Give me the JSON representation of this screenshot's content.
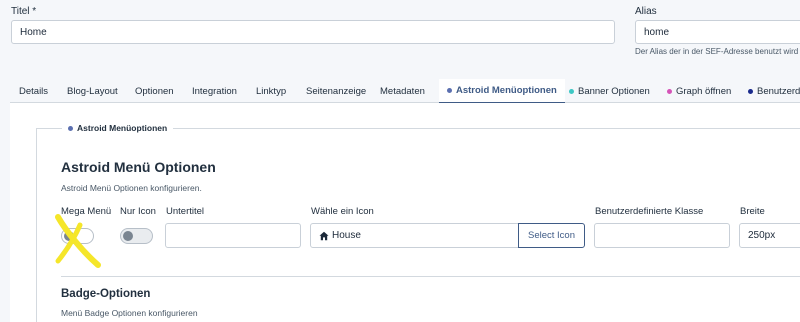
{
  "fields": {
    "title_label": "Titel *",
    "title_value": "Home",
    "alias_label": "Alias",
    "alias_value": "home",
    "alias_hint": "Der Alias der in der SEF-Adresse benutzt wird"
  },
  "tabs": [
    {
      "label": "Details"
    },
    {
      "label": "Blog-Layout"
    },
    {
      "label": "Optionen"
    },
    {
      "label": "Integration"
    },
    {
      "label": "Linktyp"
    },
    {
      "label": "Seitenanzeige"
    },
    {
      "label": "Metadaten"
    },
    {
      "label": "Astroid Menüoptionen",
      "dot": "#5b6fb0",
      "active": true
    },
    {
      "label": "Banner Optionen",
      "dot": "#3cc7c4"
    },
    {
      "label": "Graph öffnen",
      "dot": "#d554b8"
    },
    {
      "label": "Benutzerd",
      "dot": "#1a2a8c"
    }
  ],
  "fieldset": {
    "legend": "Astroid Menüoptionen",
    "legend_dot": "#5b6fb0",
    "heading": "Astroid Menü Optionen",
    "description": "Astroid Menü Optionen konfigurieren.",
    "mega_menu_label": "Mega Menü",
    "icon_only_label": "Nur Icon",
    "subtitle_label": "Untertitel",
    "subtitle_value": "",
    "icon_label": "Wähle ein Icon",
    "icon_value": "House",
    "select_icon_button": "Select Icon",
    "custom_class_label": "Benutzerdefinierte Klasse",
    "custom_class_value": "",
    "width_label": "Breite",
    "width_value": "250px",
    "badge_heading": "Badge-Optionen",
    "badge_description": "Menü Badge Optionen konfigurieren"
  },
  "colors": {
    "annotation_mark": "#f5e62a",
    "accent": "#3f5b86"
  }
}
